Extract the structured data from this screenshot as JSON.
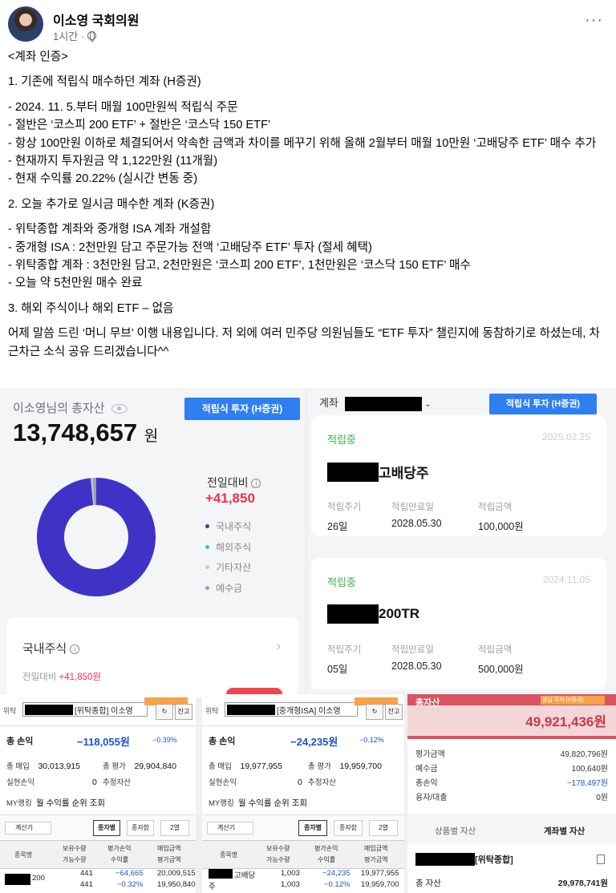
{
  "post": {
    "author": "이소영 국회의원",
    "time": "1시간 ·",
    "lines": [
      "<계좌 인증>",
      "1. 기존에 적립식 매수하던 계좌 (H증권)",
      "- 2024. 11. 5.부터 매월 100만원씩 적립식 주문",
      "- 절반은 ‘코스피 200 ETF’ + 절반은 ‘코스닥 150 ETF’",
      "- 항상 100만원 이하로 체결되어서 약속한 금액과 차이를 메꾸기 위해 올해 2월부터 매월 10만원 ‘고배당주 ETF’ 매수 추가",
      "- 현재까지 투자원금 약 1,122만원 (11개월)",
      "- 현재 수익률 20.22% (실시간 변동 중)",
      "2. 오늘 추가로 일시금 매수한 계좌 (K증권)",
      "- 위탁종합 계좌와 중개형 ISA 계좌 개설함",
      "- 중개형 ISA : 2천만원 담고 주문가능 전액 ‘고배당주 ETF’ 투자 (절세 혜택)",
      "- 위탁종합 계좌 : 3천만원 담고, 2천만원은 ‘코스피 200 ETF’, 1천만원은 ‘코스닥 150 ETF’ 매수",
      "- 오늘 약 5천만원 매수 완료",
      "3. 해외 주식이나 해외 ETF – 없음",
      "어제 말씀 드린 ‘머니 무브’ 이행 내용입니다. 저 외에 여러 민주당 의원님들도 “ETF 투자” 챌린지에 동참하기로 하셨는데, 차근차근 소식 공유 드리겠습니다^^"
    ]
  },
  "asset": {
    "title": "이소영님의 총자산",
    "amount": "13,748,657",
    "unit": "원",
    "button": "적립식 투자 (H증권)",
    "change_label": "전일대비",
    "change_value": "+41,850",
    "legend": [
      "국내주식",
      "해외주식",
      "기타자산",
      "예수금"
    ],
    "legend_colors": [
      "#3f33c7",
      "#36c3c5",
      "#c8c8d0",
      "#9ea0b8"
    ],
    "donut_shares": [
      0.985,
      0.0,
      0.005,
      0.01
    ],
    "domestic_title": "국내주식",
    "domestic_change_label": "전일대비",
    "domestic_change_value": "+41,850원"
  },
  "install": {
    "account_label": "계좌",
    "button": "적립식 투자 (H증권)",
    "cards": [
      {
        "status": "적립중",
        "date": "2025.02.25",
        "name": "고배당주",
        "cycle_label": "적립주기",
        "cycle": "26일",
        "end_label": "적립만료일",
        "end": "2028.05.30",
        "amount_label": "적립금액",
        "amount": "100,000원"
      },
      {
        "status": "적립중",
        "date": "2024.11.05",
        "name": "200TR",
        "cycle_label": "적립주기",
        "cycle": "05일",
        "end_label": "적립만료일",
        "end": "2028.05.30",
        "amount_label": "적립금액",
        "amount": "500,000원"
      }
    ]
  },
  "bp1": {
    "small": "위탁",
    "account": "[위탁종합] 이소영",
    "btn": "잔고",
    "pnl_label": "총 손익",
    "pnl": "−118,055원",
    "rate": "−0.39%",
    "buy_label": "총 매입",
    "buy": "30,013,915",
    "eval_label": "총 평가",
    "eval": "29,904,840",
    "realized_label": "실현손익",
    "realized": "0",
    "est_label": "추정자산",
    "my_label": "MY랭킹",
    "my_text": "월 수익률 순위 조회",
    "check_label": "계산기",
    "tab1": "종자별",
    "tab2": "종자함",
    "tab3": "2열",
    "head": [
      "종목명",
      "보유수량",
      "평가손익",
      "매입금액",
      "가능수량",
      "수익률",
      "평가금액"
    ],
    "row": {
      "name": "200",
      "qty": "441",
      "qty2": "441",
      "pnl": "−64,665",
      "rate": "−0.32%",
      "buy": "20,009,515",
      "eval": "19,950,840"
    }
  },
  "bp2": {
    "small": "위탁",
    "account": "[중개형ISA] 이소영",
    "btn": "잔고",
    "pnl_label": "총 손익",
    "pnl": "−24,235원",
    "rate": "−0.12%",
    "buy_label": "총 매입",
    "buy": "19,977,955",
    "eval_label": "총 평가",
    "eval": "19,959,700",
    "realized_label": "실현손익",
    "realized": "0",
    "est_label": "추정자산",
    "my_label": "MY랭킹",
    "my_text": "월 수익률 순위 조회",
    "check_label": "계산기",
    "tab1": "종자별",
    "tab2": "종자함",
    "tab3": "2열",
    "head": [
      "종목명",
      "보유수량",
      "평가손익",
      "매입금액",
      "가능수량",
      "수익률",
      "평가금액"
    ],
    "row": {
      "name": "고배당",
      "name2": "주",
      "qty": "1,003",
      "qty2": "1,003",
      "pnl": "−24,235",
      "rate": "−0.12%",
      "buy": "19,977,955",
      "eval": "19,959,700"
    }
  },
  "bp3": {
    "label": "총자산",
    "tag": "월납 투자 (K증권)",
    "total": "49,921,436원",
    "rows": [
      {
        "k": "평가금액",
        "v": "49,820,796원"
      },
      {
        "k": "예수금",
        "v": "100,640원"
      },
      {
        "k": "총손익",
        "v": "−178,497원"
      },
      {
        "k": "융자/대출",
        "v": "0원"
      }
    ],
    "tab1": "상품별 자산",
    "tab2": "계좌별 자산",
    "account": "[위탁종합]",
    "bottom_label": "총 자산",
    "bottom_value": "29,978,741원"
  }
}
